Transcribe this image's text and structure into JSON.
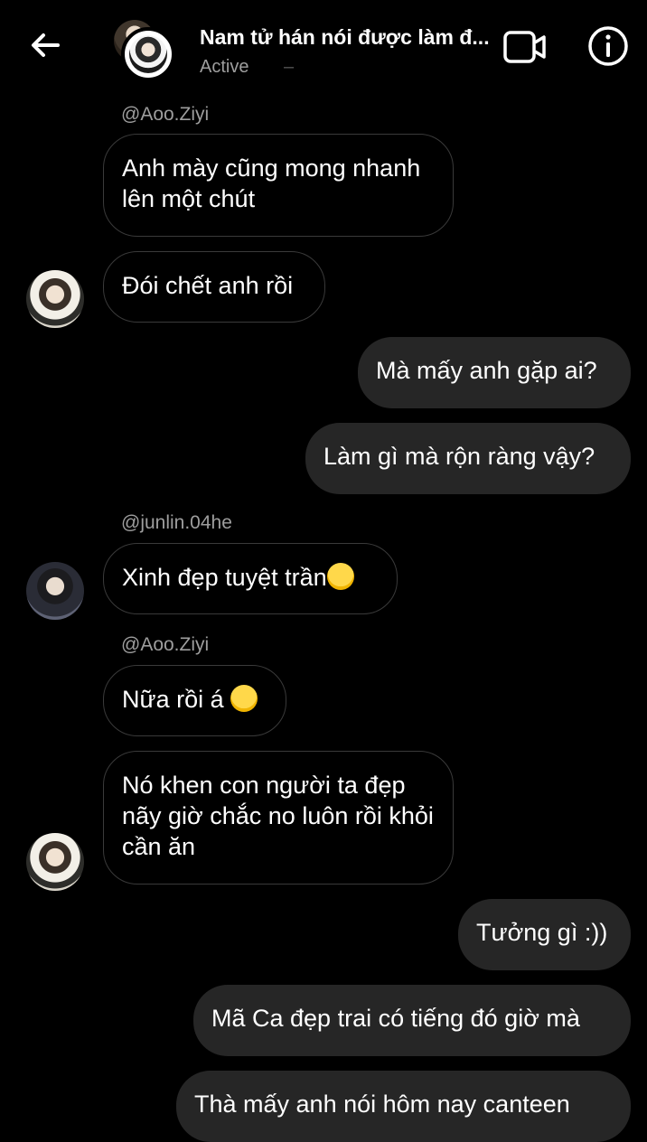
{
  "header": {
    "title": "Nam tử hán nói được làm đ...",
    "status": "Active",
    "status_extra": "–"
  },
  "messages": [
    {
      "handle": "@Aoo.Ziyi"
    },
    {
      "text": "Anh mày cũng mong nhanh lên một chút"
    },
    {
      "text": "Đói chết anh rồi"
    },
    {
      "text": "Mà mấy anh gặp ai?"
    },
    {
      "text": "Làm gì mà rộn ràng vậy?"
    },
    {
      "handle": "@junlin.04he"
    },
    {
      "text": "Xinh đẹp tuyệt trần",
      "emoji": "loudly-crying-face"
    },
    {
      "handle": "@Aoo.Ziyi"
    },
    {
      "text": "Nữa rồi á",
      "emoji": "smiling-face"
    },
    {
      "text": "Nó khen con người ta đẹp nãy giờ chắc no luôn rồi khỏi cần ăn"
    },
    {
      "text": "Tưởng gì :))"
    },
    {
      "text": "Mã Ca đẹp trai có tiếng đó giờ mà"
    },
    {
      "text": "Thà mấy anh nói hôm nay canteen"
    }
  ],
  "icons": {
    "back": "arrow-left-icon",
    "video": "video-camera-icon",
    "info": "info-icon"
  },
  "colors": {
    "background": "#000000",
    "outgoing_bubble": "#262626",
    "incoming_border": "#3a3a3a",
    "secondary_text": "#9e9e9e"
  }
}
